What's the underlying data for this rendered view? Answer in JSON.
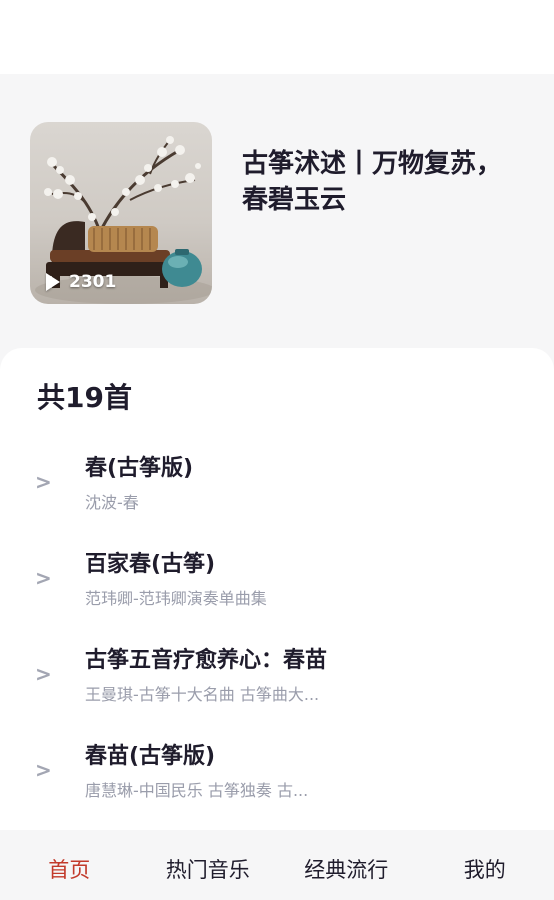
{
  "album": {
    "title": "古筝沭述丨万物复苏，春碧玉云",
    "play_count": "2301"
  },
  "list": {
    "count_label": "共19首",
    "songs": [
      {
        "title": "春(古筝版)",
        "subtitle": "沈波-春"
      },
      {
        "title": "百家春(古筝)",
        "subtitle": "范玮卿-范玮卿演奏单曲集"
      },
      {
        "title": "古筝五音疗愈养心：春苗",
        "subtitle": "王曼琪-古筝十大名曲 古筝曲大..."
      },
      {
        "title": "春苗(古筝版)",
        "subtitle": "唐慧琳-中国民乐 古筝独奏 古..."
      }
    ],
    "arrow": ">"
  },
  "tabbar": {
    "tabs": [
      {
        "label": "首页",
        "active": true
      },
      {
        "label": "热门音乐",
        "active": false
      },
      {
        "label": "经典流行",
        "active": false
      },
      {
        "label": "我的",
        "active": false
      }
    ],
    "active_color": "#c23a2b"
  }
}
